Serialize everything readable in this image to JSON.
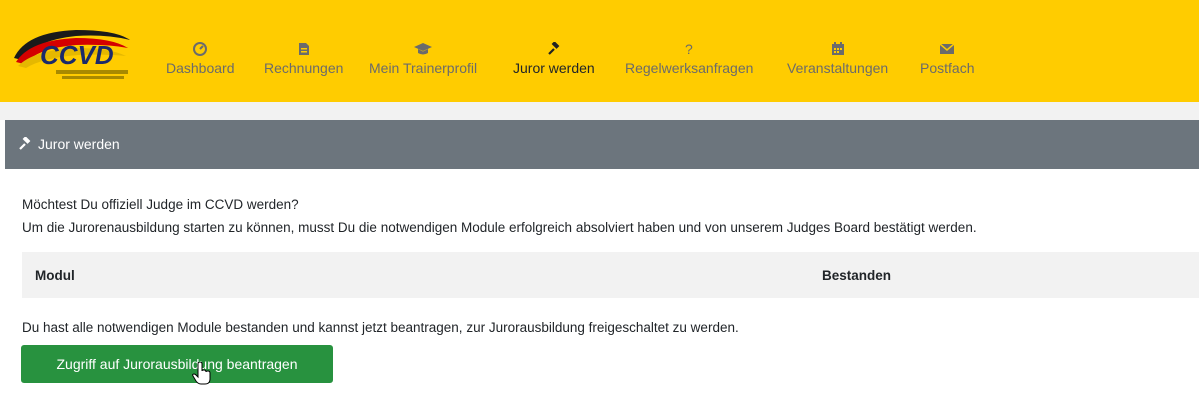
{
  "brand": {
    "logo_text": "CCVD"
  },
  "nav": {
    "items": [
      {
        "label": "Dashboard",
        "icon": "dashboard-icon"
      },
      {
        "label": "Rechnungen",
        "icon": "invoice-icon"
      },
      {
        "label": "Mein Trainerprofil",
        "icon": "graduation-cap-icon"
      },
      {
        "label": "Juror werden",
        "icon": "gavel-icon",
        "active": true
      },
      {
        "label": "Regelwerksanfragen",
        "icon": "question-icon"
      },
      {
        "label": "Veranstaltungen",
        "icon": "calendar-icon"
      },
      {
        "label": "Postfach",
        "icon": "envelope-icon"
      }
    ]
  },
  "section": {
    "title": "Juror werden",
    "icon": "gavel-icon"
  },
  "content": {
    "intro_line1": "Möchtest Du offiziell Judge im CCVD werden?",
    "intro_line2": "Um die Jurorenausbildung starten zu können, musst Du die notwendigen Module erfolgreich absolviert haben und von unserem Judges Board bestätigt werden.",
    "table": {
      "columns": [
        "Modul",
        "Bestanden"
      ],
      "rows": []
    },
    "info": "Du hast alle notwendigen Module bestanden und kannst jetzt beantragen, zur Jurorausbildung freigeschaltet zu werden.",
    "button_label": "Zugriff auf Jurorausbildung beantragen"
  },
  "colors": {
    "nav_bg": "#ffcc00",
    "section_bg": "#6c757d",
    "button_bg": "#28923f"
  }
}
